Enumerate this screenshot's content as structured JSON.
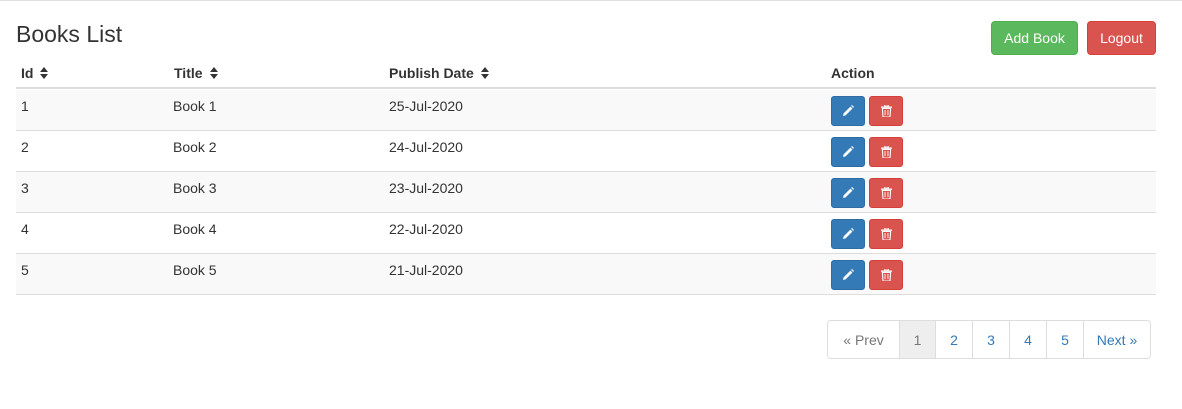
{
  "header": {
    "title": "Books List",
    "add_label": "Add Book",
    "logout_label": "Logout"
  },
  "table": {
    "columns": [
      "Id",
      "Title",
      "Publish Date",
      "Action"
    ],
    "rows": [
      {
        "id": "1",
        "title": "Book 1",
        "date": "25-Jul-2020"
      },
      {
        "id": "2",
        "title": "Book 2",
        "date": "24-Jul-2020"
      },
      {
        "id": "3",
        "title": "Book 3",
        "date": "23-Jul-2020"
      },
      {
        "id": "4",
        "title": "Book 4",
        "date": "22-Jul-2020"
      },
      {
        "id": "5",
        "title": "Book 5",
        "date": "21-Jul-2020"
      }
    ],
    "row_actions": {
      "edit_icon": "pencil-icon",
      "delete_icon": "trash-icon"
    }
  },
  "pagination": {
    "prev": "« Prev",
    "pages": [
      "1",
      "2",
      "3",
      "4",
      "5"
    ],
    "current": "1",
    "next": "Next »"
  },
  "colors": {
    "success": "#5cb85c",
    "danger": "#d9534f",
    "primary": "#337ab7"
  }
}
